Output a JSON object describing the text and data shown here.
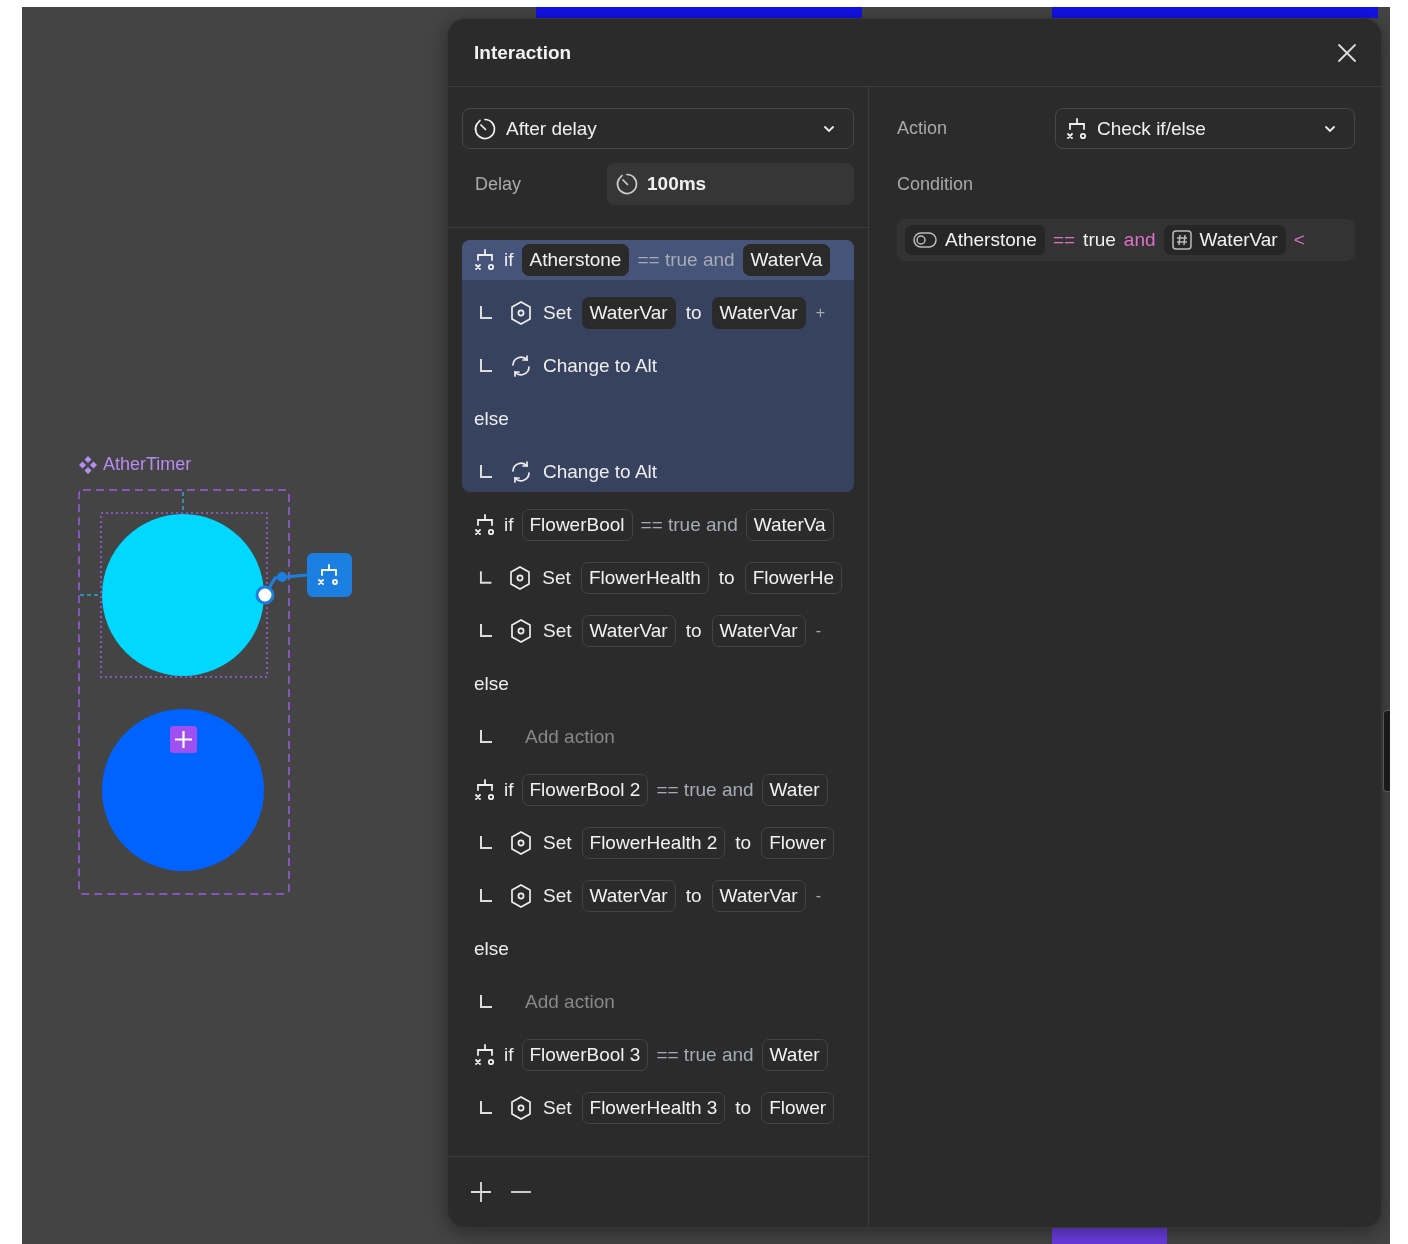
{
  "canvas": {
    "component_label": "AtherTimer",
    "shapes": [
      {
        "kind": "circle",
        "color": "#00d8ff",
        "selected": true
      },
      {
        "kind": "circle",
        "color": "#0063ff",
        "selected": false
      }
    ]
  },
  "panel": {
    "title": "Interaction",
    "trigger": {
      "value": "After delay"
    },
    "delay": {
      "label": "Delay",
      "value": "100ms"
    },
    "blocks": [
      {
        "selected": true,
        "keyword": "if",
        "var": "Atherstone",
        "op": "== true and",
        "var2": "WaterVa",
        "actions": [
          {
            "kind": "set",
            "verb": "Set",
            "target": "WaterVar",
            "joiner": "to",
            "value": "WaterVar",
            "tail": "+"
          },
          {
            "kind": "change",
            "text": "Change to Alt"
          }
        ],
        "else_label": "else",
        "else_actions": [
          {
            "kind": "change",
            "text": "Change to Alt"
          }
        ]
      },
      {
        "selected": false,
        "keyword": "if",
        "var": "FlowerBool",
        "op": "== true and",
        "var2": "WaterVa",
        "actions": [
          {
            "kind": "set",
            "verb": "Set",
            "target": "FlowerHealth",
            "joiner": "to",
            "value": "FlowerHe"
          },
          {
            "kind": "set",
            "verb": "Set",
            "target": "WaterVar",
            "joiner": "to",
            "value": "WaterVar",
            "tail": "-"
          }
        ],
        "else_label": "else",
        "else_actions": [
          {
            "kind": "add",
            "text": "Add action"
          }
        ]
      },
      {
        "selected": false,
        "keyword": "if",
        "var": "FlowerBool 2",
        "op": "== true and",
        "var2": "Water",
        "actions": [
          {
            "kind": "set",
            "verb": "Set",
            "target": "FlowerHealth 2",
            "joiner": "to",
            "value": "Flower"
          },
          {
            "kind": "set",
            "verb": "Set",
            "target": "WaterVar",
            "joiner": "to",
            "value": "WaterVar",
            "tail": "-"
          }
        ],
        "else_label": "else",
        "else_actions": [
          {
            "kind": "add",
            "text": "Add action"
          }
        ]
      },
      {
        "selected": false,
        "keyword": "if",
        "var": "FlowerBool 3",
        "op": "== true and",
        "var2": "Water",
        "actions": [
          {
            "kind": "set",
            "verb": "Set",
            "target": "FlowerHealth 3",
            "joiner": "to",
            "value": "Flower"
          }
        ]
      }
    ],
    "action": {
      "label": "Action",
      "value": "Check if/else"
    },
    "condition": {
      "label": "Condition",
      "parts": [
        {
          "kind": "bool_var",
          "text": "Atherstone"
        },
        {
          "kind": "operator",
          "text": "=="
        },
        {
          "kind": "value",
          "text": "true"
        },
        {
          "kind": "operator",
          "text": "and"
        },
        {
          "kind": "number_var",
          "text": "WaterVar"
        },
        {
          "kind": "operator",
          "text": "<"
        }
      ]
    }
  }
}
